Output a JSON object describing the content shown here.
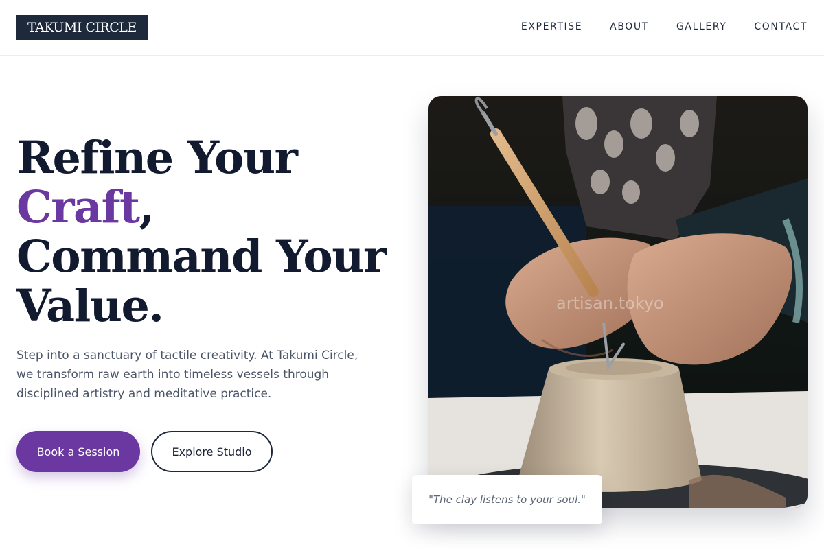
{
  "brand": {
    "name": "TAKUMI CIRCLE"
  },
  "nav": {
    "items": [
      {
        "label": "EXPERTISE"
      },
      {
        "label": "ABOUT"
      },
      {
        "label": "GALLERY"
      },
      {
        "label": "CONTACT"
      }
    ]
  },
  "hero": {
    "headline_line1": "Refine Your",
    "headline_accent": "Craft",
    "headline_comma": ",",
    "headline_line3": "Command Your",
    "headline_line4": "Value.",
    "subtext": "Step into a sanctuary of tactile creativity. At Takumi Circle, we transform raw earth into timeless vessels through disciplined artistry and meditative practice.",
    "primary_cta": "Book a Session",
    "secondary_cta": "Explore Studio"
  },
  "image": {
    "watermark": "artisan.tokyo",
    "quote": "\"The clay listens to your soul.\""
  },
  "colors": {
    "brand_dark": "#1e293b",
    "accent": "#6b37a0",
    "body_text": "#4b5568"
  }
}
